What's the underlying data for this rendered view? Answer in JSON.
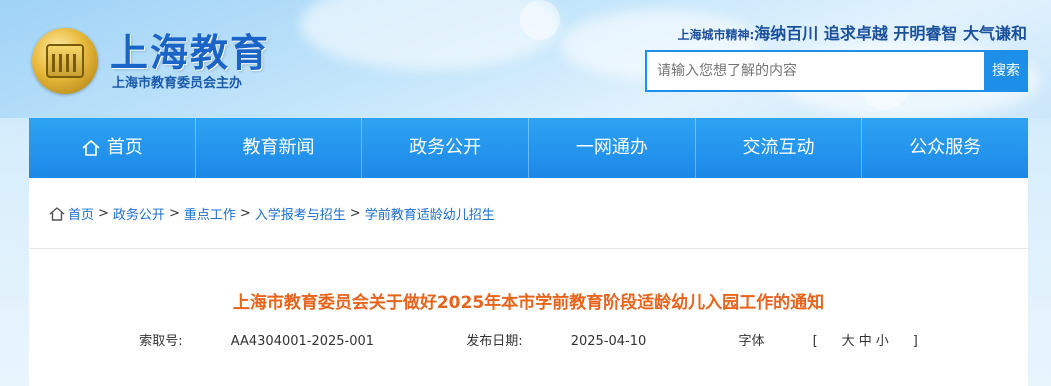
{
  "header": {
    "logo_title": "上海教育",
    "logo_subtitle": "上海市教育委员会主办",
    "spirit_label": "上海城市精神:",
    "spirit_text": "海纳百川 追求卓越 开明睿智 大气谦和",
    "search_placeholder": "请输入您想了解的内容",
    "search_button": "搜索"
  },
  "nav": {
    "items": [
      {
        "label": "首页",
        "icon": "home-icon"
      },
      {
        "label": "教育新闻"
      },
      {
        "label": "政务公开"
      },
      {
        "label": "一网通办"
      },
      {
        "label": "交流互动"
      },
      {
        "label": "公众服务"
      }
    ]
  },
  "breadcrumb": {
    "home_icon": "home-icon",
    "items": [
      "首页",
      "政务公开",
      "重点工作",
      "入学报考与招生",
      "学前教育适龄幼儿招生"
    ],
    "separator": ">"
  },
  "article": {
    "title": "上海市教育委员会关于做好2025年本市学前教育阶段适龄幼儿入园工作的通知",
    "index_label": "索取号:",
    "index_value": "AA4304001-2025-001",
    "date_label": "发布日期:",
    "date_value": "2025-04-10",
    "font_label": "字体",
    "font_open": "[",
    "font_large": "大",
    "font_medium": "中",
    "font_small": "小",
    "font_close": "]"
  },
  "colors": {
    "nav_bg": "#1c88e8",
    "title_color": "#e8641c",
    "link_color": "#1a6fd0",
    "logo_blue": "#1a64c8"
  }
}
